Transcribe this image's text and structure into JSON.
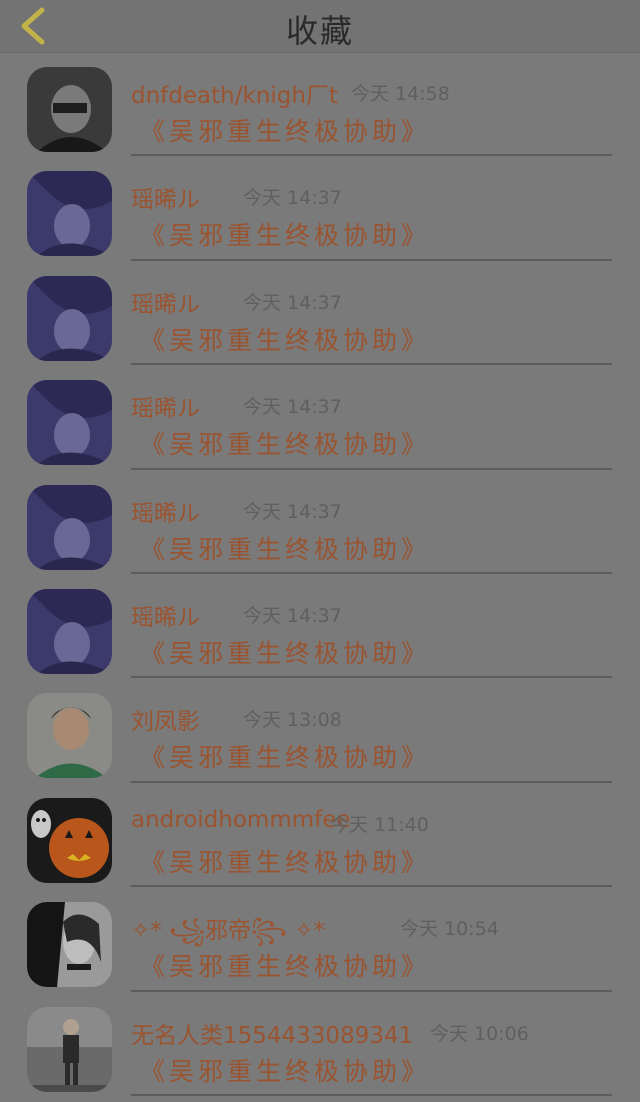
{
  "header": {
    "title": "收藏",
    "back_icon": "chevron-left-icon",
    "accent": "#c2b24a"
  },
  "items": [
    {
      "name": "dnfdeath/knigh厂t",
      "time": "今天 14:58",
      "message": "《吴邪重生终极协助》",
      "avatar": "masked-portrait"
    },
    {
      "name": "瑶晞ル",
      "time": "今天 14:37",
      "message": "《吴邪重生终极协助》",
      "avatar": "purple-anime"
    },
    {
      "name": "瑶晞ル",
      "time": "今天 14:37",
      "message": "《吴邪重生终极协助》",
      "avatar": "purple-anime"
    },
    {
      "name": "瑶晞ル",
      "time": "今天 14:37",
      "message": "《吴邪重生终极协助》",
      "avatar": "purple-anime"
    },
    {
      "name": "瑶晞ル",
      "time": "今天 14:37",
      "message": "《吴邪重生终极协助》",
      "avatar": "purple-anime"
    },
    {
      "name": "瑶晞ル",
      "time": "今天 14:37",
      "message": "《吴邪重生终极协助》",
      "avatar": "purple-anime"
    },
    {
      "name": "刘凤影",
      "time": "今天 13:08",
      "message": "《吴邪重生终极协助》",
      "avatar": "boy-photo"
    },
    {
      "name": "androidhommmfee",
      "time": "今天 11:40",
      "message": "《吴邪重生终极协助》",
      "avatar": "pumpkin"
    },
    {
      "name": "✧* ꧁邪帝꧂ ✧*",
      "time": "今天 10:54",
      "message": "《吴邪重生终极协助》",
      "avatar": "bw-anime"
    },
    {
      "name": "无名人类15544330893​41",
      "time": "今天 10:06",
      "message": "《吴邪重生终极协助》",
      "avatar": "standing-person"
    }
  ]
}
